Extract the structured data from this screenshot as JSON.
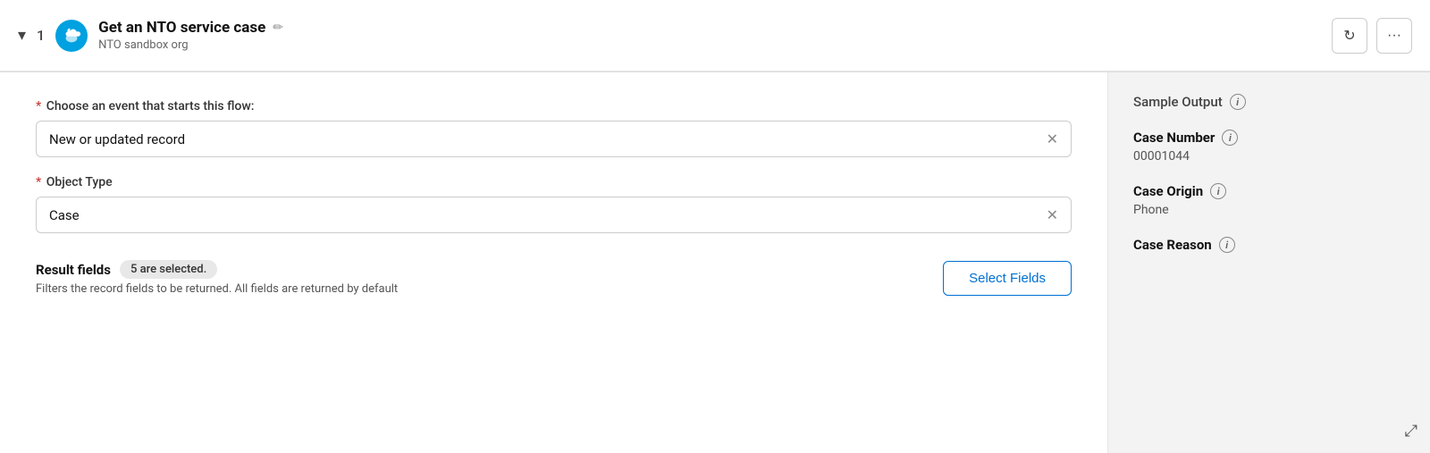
{
  "header": {
    "chevron_label": "▾",
    "step_number": "1",
    "title": "Get an NTO service case",
    "subtitle": "NTO sandbox org",
    "edit_icon": "✏",
    "refresh_icon": "↻",
    "more_icon": "···"
  },
  "main": {
    "event_label": "Choose an event that starts this flow:",
    "event_value": "New or updated record",
    "object_type_label": "Object Type",
    "object_type_value": "Case",
    "result_fields_label": "Result fields",
    "result_fields_badge": "5 are selected.",
    "result_fields_desc": "Filters the record fields to be returned. All fields are returned by default",
    "select_fields_button": "Select Fields"
  },
  "sidebar": {
    "sample_output_title": "Sample Output",
    "fields": [
      {
        "name": "Case Number",
        "value": "00001044"
      },
      {
        "name": "Case Origin",
        "value": "Phone"
      },
      {
        "name": "Case Reason",
        "value": ""
      }
    ]
  }
}
